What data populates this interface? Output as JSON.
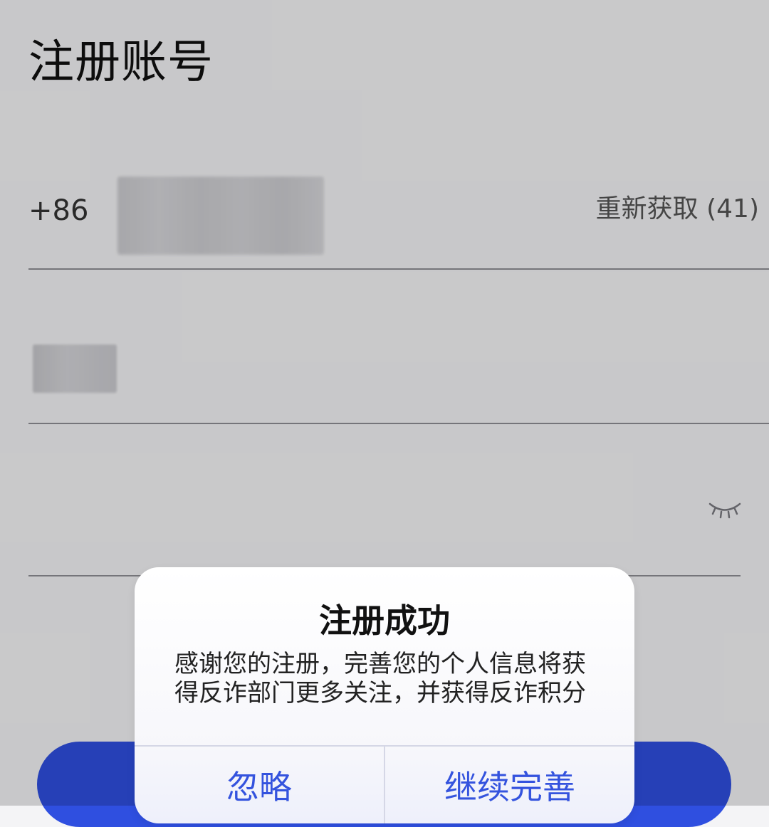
{
  "page": {
    "title": "注册账号"
  },
  "phone_row": {
    "country_code": "+86",
    "resend_label": "重新获取 (41)"
  },
  "password_row": {
    "toggle_icon": "eye-closed-icon"
  },
  "dialog": {
    "title": "注册成功",
    "message": "感谢您的注册，完善您的个人信息将获得反诈部门更多关注，并获得反诈积分",
    "ignore_label": "忽略",
    "continue_label": "继续完善"
  },
  "colors": {
    "accent": "#3453de",
    "primary_button": "#2f4fe0"
  }
}
